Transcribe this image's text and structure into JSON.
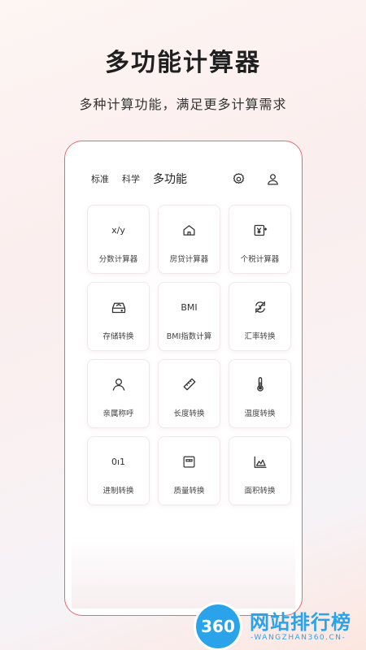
{
  "header": {
    "title": "多功能计算器",
    "subtitle": "多种计算功能，满足更多计算需求"
  },
  "app": {
    "tabs": [
      {
        "label": "标准",
        "active": false
      },
      {
        "label": "科学",
        "active": false
      },
      {
        "label": "多功能",
        "active": true
      }
    ],
    "icons": {
      "settings": "gear-icon",
      "profile": "user-icon"
    },
    "accent_color": "#e36a73",
    "tools": [
      {
        "label": "分数计算器",
        "icon": "x/y"
      },
      {
        "label": "房贷计算器",
        "icon": "house-icon"
      },
      {
        "label": "个税计算器",
        "icon": "tax-icon"
      },
      {
        "label": "存储转换",
        "icon": "storage-icon"
      },
      {
        "label": "BMI指数计算",
        "icon": "BMI"
      },
      {
        "label": "汇率转换",
        "icon": "exchange-icon"
      },
      {
        "label": "亲属称呼",
        "icon": "person-icon"
      },
      {
        "label": "长度转换",
        "icon": "ruler-icon"
      },
      {
        "label": "温度转换",
        "icon": "thermometer-icon"
      },
      {
        "label": "进制转换",
        "icon": "0ı1"
      },
      {
        "label": "质量转换",
        "icon": "scale-icon"
      },
      {
        "label": "面积转换",
        "icon": "area-chart-icon"
      }
    ]
  },
  "watermark": {
    "badge": "360",
    "title": "网站排行榜",
    "subtitle": "-WANGZHAN360.CN-"
  }
}
